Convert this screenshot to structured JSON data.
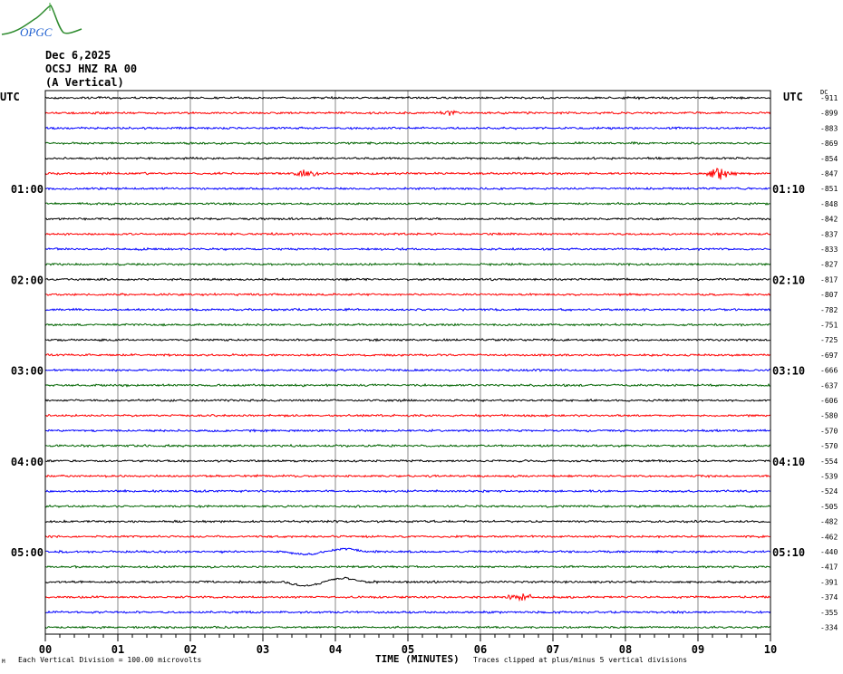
{
  "logo": {
    "text": "OPGC"
  },
  "header": {
    "date": "Dec 6,2025",
    "station": "OCSJ HNZ RA 00",
    "component": "(A Vertical)"
  },
  "left_axis_title": "UTC",
  "right_axis_title": "UTC",
  "dc_title": "DC",
  "footer": {
    "mark": "M",
    "scale": "Each Vertical Division =  100.00 microvolts",
    "clip": "Traces clipped at plus/minus 5 vertical divisions"
  },
  "chart_data": {
    "type": "line",
    "subtype": "helicorder",
    "xlabel": "TIME (MINUTES)",
    "xlim": [
      0,
      10
    ],
    "x_ticks": [
      "00",
      "01",
      "02",
      "03",
      "04",
      "05",
      "06",
      "07",
      "08",
      "09",
      "10"
    ],
    "colors": [
      "#000000",
      "#ff0000",
      "#0000ff",
      "#006400"
    ],
    "left_labels": [
      {
        "row": 6,
        "text": "01:00"
      },
      {
        "row": 12,
        "text": "02:00"
      },
      {
        "row": 18,
        "text": "03:00"
      },
      {
        "row": 24,
        "text": "04:00"
      },
      {
        "row": 30,
        "text": "05:00"
      }
    ],
    "right_labels": [
      {
        "row": 6,
        "text": "01:10"
      },
      {
        "row": 12,
        "text": "02:10"
      },
      {
        "row": 18,
        "text": "03:10"
      },
      {
        "row": 24,
        "text": "04:10"
      },
      {
        "row": 30,
        "text": "05:10"
      }
    ],
    "dc_offsets": [
      "-911",
      "-899",
      "-883",
      "-869",
      "-854",
      "-847",
      "-851",
      "-848",
      "-842",
      "-837",
      "-833",
      "-827",
      "-817",
      "-807",
      "-782",
      "-751",
      "-725",
      "-697",
      "-666",
      "-637",
      "-606",
      "-580",
      "-570",
      "-570",
      "-554",
      "-539",
      "-524",
      "-505",
      "-482",
      "-462",
      "-440",
      "-417",
      "-391",
      "-374",
      "-355",
      "-334"
    ],
    "events": [
      {
        "row": 5,
        "minute": 9.3,
        "amplitude": 4,
        "type": "spike"
      },
      {
        "row": 5,
        "minute": 3.6,
        "amplitude": 2,
        "type": "spike"
      },
      {
        "row": 1,
        "minute": 5.55,
        "amplitude": 1.5,
        "type": "spike"
      },
      {
        "row": 30,
        "minute_start": 3.3,
        "minute_end": 4.4,
        "amplitude": 1.5,
        "type": "long-period"
      },
      {
        "row": 32,
        "minute_start": 3.3,
        "minute_end": 4.4,
        "amplitude": 2,
        "type": "long-period"
      },
      {
        "row": 33,
        "minute": 6.55,
        "amplitude": 2,
        "type": "spike"
      }
    ]
  }
}
